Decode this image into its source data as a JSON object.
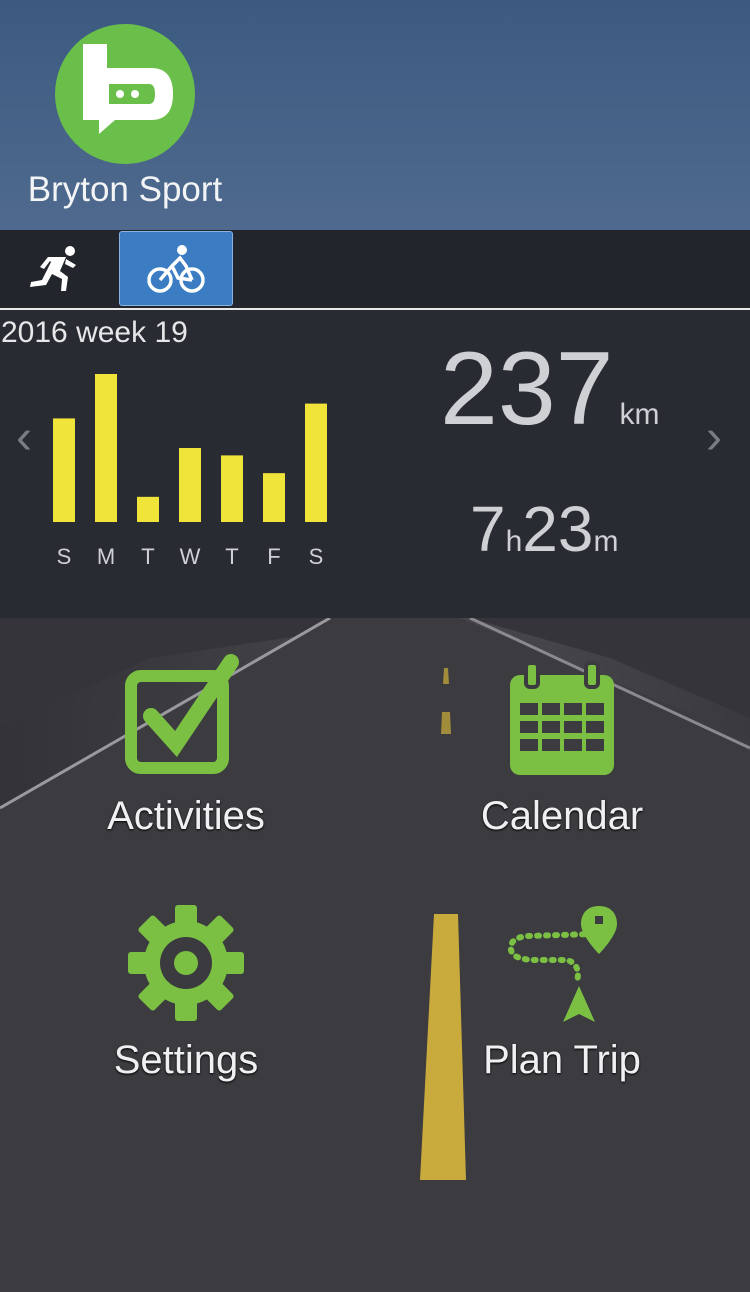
{
  "brand": {
    "name": "Bryton Sport",
    "color": "#6abf4b"
  },
  "tabs": [
    {
      "icon": "running-icon",
      "active": false
    },
    {
      "icon": "cycling-icon",
      "active": true
    }
  ],
  "summary": {
    "week_label": "2016 week 19",
    "distance_value": "237",
    "distance_unit": "km",
    "hours": "7",
    "hours_unit": "h",
    "minutes": "23",
    "minutes_unit": "m"
  },
  "chart_data": {
    "type": "bar",
    "categories": [
      "S",
      "M",
      "T",
      "W",
      "T",
      "F",
      "S"
    ],
    "values": [
      0.7,
      1.0,
      0.17,
      0.5,
      0.45,
      0.33,
      0.8
    ],
    "bar_color": "#f0e43a"
  },
  "menu": {
    "activities": "Activities",
    "calendar": "Calendar",
    "settings": "Settings",
    "plan_trip": "Plan Trip",
    "accent_color": "#7bc043"
  }
}
